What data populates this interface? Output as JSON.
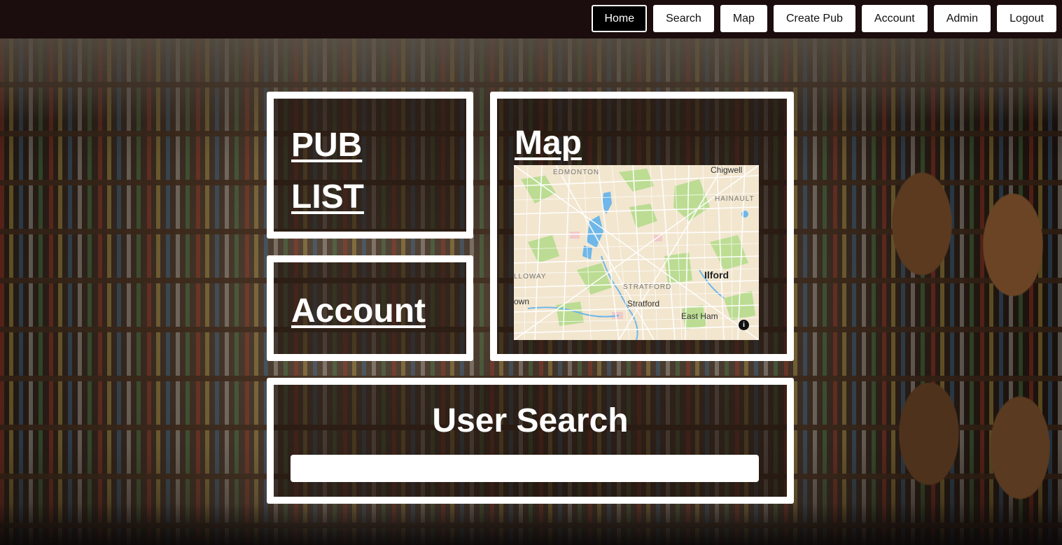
{
  "nav": {
    "items": [
      {
        "label": "Home",
        "active": true
      },
      {
        "label": "Search",
        "active": false
      },
      {
        "label": "Map",
        "active": false
      },
      {
        "label": "Create Pub",
        "active": false
      },
      {
        "label": "Account",
        "active": false
      },
      {
        "label": "Admin",
        "active": false
      },
      {
        "label": "Logout",
        "active": false
      }
    ]
  },
  "cards": {
    "pub_list": "PUB LIST",
    "account": "Account",
    "map": "Map",
    "user_search": {
      "title": "User Search",
      "value": "",
      "placeholder": ""
    }
  },
  "map": {
    "labels": {
      "edmonton": "EDMONTON",
      "chigwell": "Chigwell",
      "hainault": "HAINAULT",
      "holloway": "LLOWAY",
      "stratford_district": "STRATFORD",
      "ilford": "Ilford",
      "stratford": "Stratford",
      "town": "own",
      "east_ham": "East Ham"
    },
    "info_glyph": "i",
    "colors": {
      "land": "#f2e6cf",
      "park": "#b9dc8f",
      "water": "#6fb7e8",
      "road": "#ffffff"
    }
  },
  "icons": {
    "info": "info-icon"
  }
}
